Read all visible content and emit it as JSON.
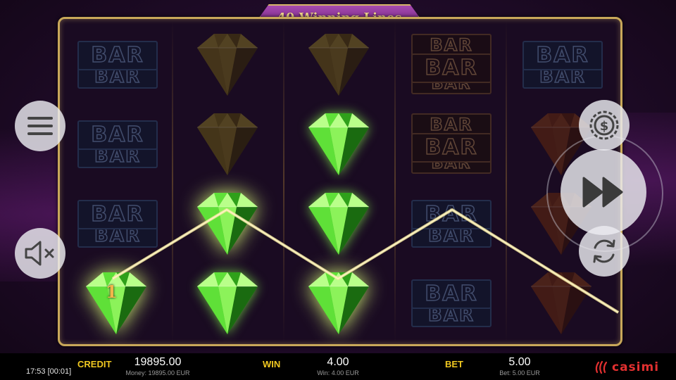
{
  "title": "40 Winning Lines",
  "win_line_number": "1",
  "reels": [
    [
      "bar",
      "bar",
      "bar",
      "green-gem-win"
    ],
    [
      "gold-gem",
      "gold-gem",
      "green-gem-win",
      "green-gem"
    ],
    [
      "gold-gem",
      "green-gem",
      "green-gem",
      "green-gem-win"
    ],
    [
      "triple-bar",
      "triple-bar",
      "bar",
      "bar"
    ],
    [
      "bar",
      "red-gem",
      "red-gem",
      "red-gem"
    ]
  ],
  "footer": {
    "credit_label": "CREDIT",
    "credit_value": "19895.00",
    "credit_sub": "Money: 19895.00 EUR",
    "win_label": "WIN",
    "win_value": "4.00",
    "win_sub": "Win: 4.00 EUR",
    "bet_label": "BET",
    "bet_value": "5.00",
    "bet_sub": "Bet: 5.00 EUR",
    "clock": "17:53 [00:01]",
    "brand": "casimi"
  },
  "buttons": {
    "menu": "menu-icon",
    "sound": "speaker-muted-icon",
    "bet": "coin-dollar-icon",
    "spin": "fast-forward-icon",
    "autoplay": "refresh-icon"
  }
}
